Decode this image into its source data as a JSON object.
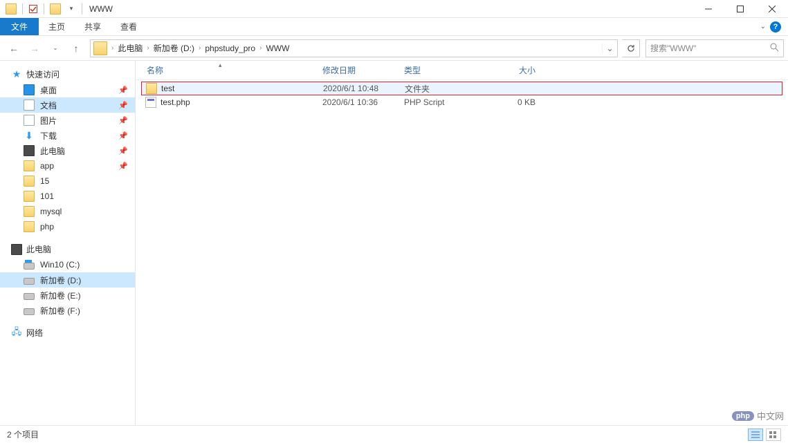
{
  "window": {
    "title": "WWW"
  },
  "ribbon": {
    "file": "文件",
    "home": "主页",
    "share": "共享",
    "view": "查看"
  },
  "nav": {
    "breadcrumb": [
      "此电脑",
      "新加卷 (D:)",
      "phpstudy_pro",
      "WWW"
    ],
    "search_placeholder": "搜索\"WWW\""
  },
  "sidebar": {
    "quick": {
      "label": "快速访问"
    },
    "quick_items": [
      {
        "label": "桌面",
        "pinned": true,
        "icon": "desktop"
      },
      {
        "label": "文档",
        "pinned": true,
        "icon": "doc",
        "selected": true
      },
      {
        "label": "图片",
        "pinned": true,
        "icon": "pic"
      },
      {
        "label": "下载",
        "pinned": true,
        "icon": "dl"
      },
      {
        "label": "此电脑",
        "pinned": true,
        "icon": "pc"
      },
      {
        "label": "app",
        "pinned": true,
        "icon": "folder"
      },
      {
        "label": "15",
        "pinned": false,
        "icon": "folder"
      },
      {
        "label": "101",
        "pinned": false,
        "icon": "folder"
      },
      {
        "label": "mysql",
        "pinned": false,
        "icon": "folder"
      },
      {
        "label": "php",
        "pinned": false,
        "icon": "folder"
      }
    ],
    "thispc": {
      "label": "此电脑"
    },
    "drives": [
      {
        "label": "Win10 (C:)",
        "icon": "osdrive"
      },
      {
        "label": "新加卷 (D:)",
        "icon": "drive",
        "selected": true
      },
      {
        "label": "新加卷 (E:)",
        "icon": "drive"
      },
      {
        "label": "新加卷 (F:)",
        "icon": "drive"
      }
    ],
    "network": {
      "label": "网络"
    }
  },
  "columns": {
    "name": "名称",
    "date": "修改日期",
    "type": "类型",
    "size": "大小"
  },
  "files": [
    {
      "name": "test",
      "date": "2020/6/1 10:48",
      "type": "文件夹",
      "size": "",
      "icon": "folder",
      "highlight": true
    },
    {
      "name": "test.php",
      "date": "2020/6/1 10:36",
      "type": "PHP Script",
      "size": "0 KB",
      "icon": "php",
      "highlight": false
    }
  ],
  "status": {
    "count": "2 个项目"
  },
  "watermark": {
    "logo": "php",
    "text": "中文网"
  }
}
